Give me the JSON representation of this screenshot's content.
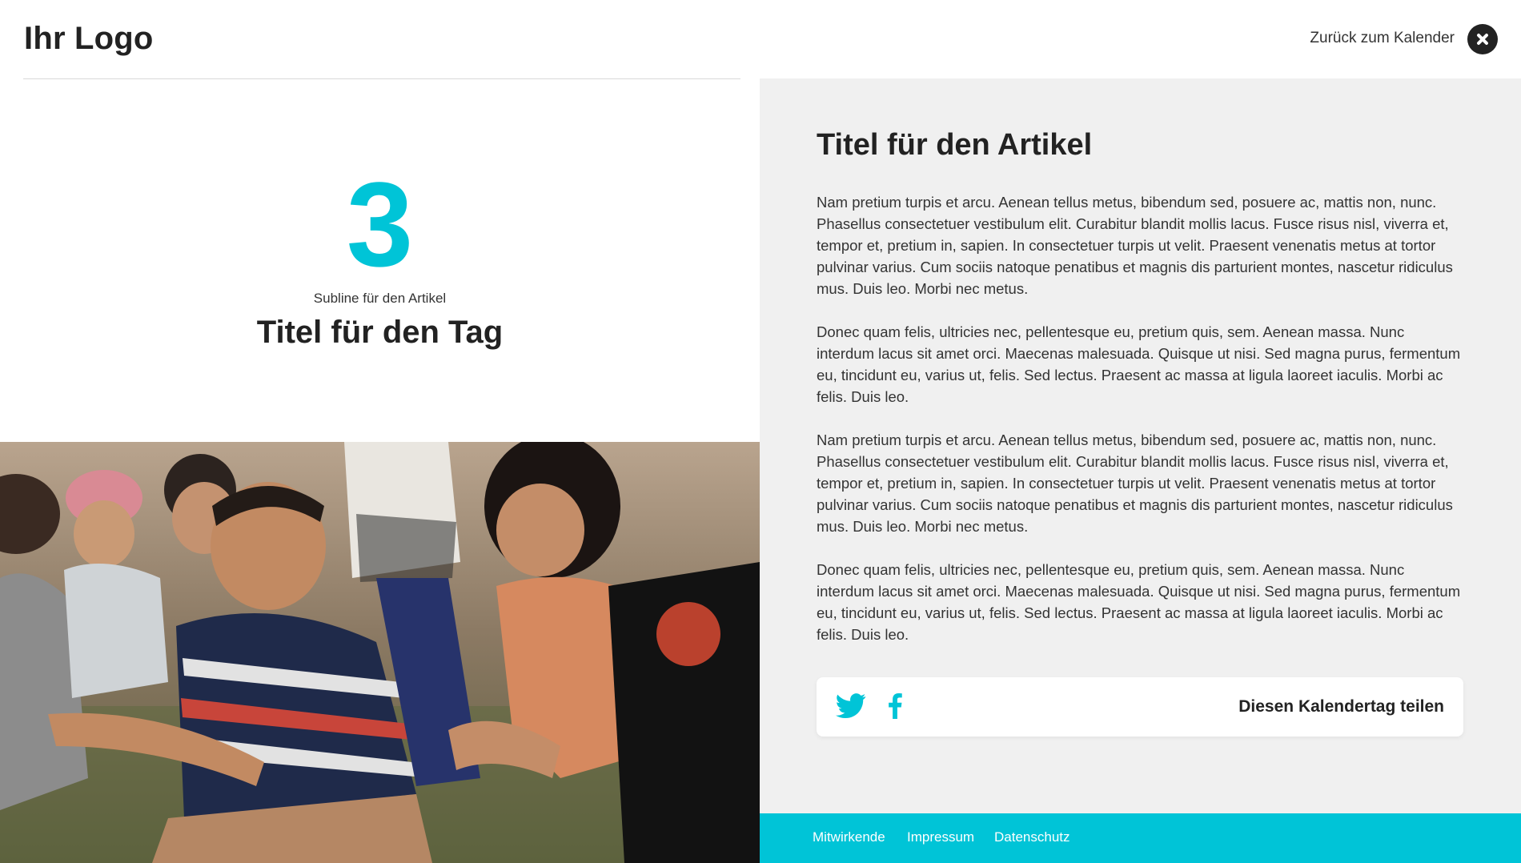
{
  "header": {
    "logo": "Ihr Logo",
    "back_link": "Zurück zum Kalender"
  },
  "day": {
    "number": "3",
    "subline": "Subline für den Artikel",
    "title": "Titel für den Tag"
  },
  "article": {
    "title": "Titel für den Artikel",
    "paragraphs": [
      "Nam pretium turpis et arcu. Aenean tellus metus, bibendum sed, posuere ac, mattis non, nunc. Phasellus consectetuer vestibulum elit. Curabitur blandit mollis lacus. Fusce risus nisl, viverra et, tempor et, pretium in, sapien. In consectetuer turpis ut velit. Praesent venenatis metus at tortor pulvinar varius. Cum sociis natoque penatibus et magnis dis parturient montes, nascetur ridiculus mus. Duis leo. Morbi nec metus.",
      "Donec quam felis, ultricies nec, pellentesque eu, pretium quis, sem. Aenean massa. Nunc interdum lacus sit amet orci. Maecenas malesuada. Quisque ut nisi. Sed magna purus, fermentum eu, tincidunt eu, varius ut, felis. Sed lectus. Praesent ac massa at ligula laoreet iaculis. Morbi ac felis. Duis leo.",
      "Nam pretium turpis et arcu. Aenean tellus metus, bibendum sed, posuere ac, mattis non, nunc. Phasellus consectetuer vestibulum elit. Curabitur blandit mollis lacus. Fusce risus nisl, viverra et, tempor et, pretium in, sapien. In consectetuer turpis ut velit. Praesent venenatis metus at tortor pulvinar varius. Cum sociis natoque penatibus et magnis dis parturient montes, nascetur ridiculus mus. Duis leo. Morbi nec metus.",
      "Donec quam felis, ultricies nec, pellentesque eu, pretium quis, sem. Aenean massa. Nunc interdum lacus sit amet orci. Maecenas malesuada. Quisque ut nisi. Sed magna purus, fermentum eu, tincidunt eu, varius ut, felis. Sed lectus. Praesent ac massa at ligula laoreet iaculis. Morbi ac felis. Duis leo."
    ]
  },
  "share": {
    "label": "Diesen Kalendertag teilen",
    "icons": [
      "twitter-icon",
      "facebook-icon"
    ]
  },
  "footer": {
    "links": [
      "Mitwirkende",
      "Impressum",
      "Datenschutz"
    ]
  },
  "colors": {
    "accent": "#00c4d7",
    "text": "#222222",
    "panel": "#f0f0f0"
  }
}
